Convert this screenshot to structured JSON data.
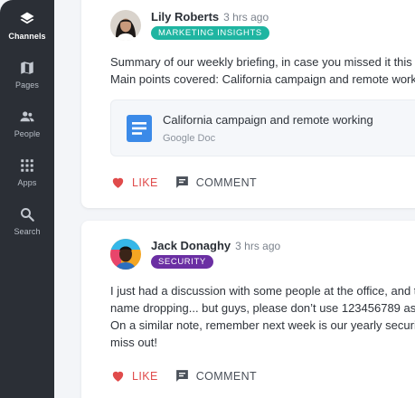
{
  "sidebar": {
    "items": [
      {
        "label": "Channels",
        "icon": "layers-icon",
        "active": true
      },
      {
        "label": "Pages",
        "icon": "map-pages-icon",
        "active": false
      },
      {
        "label": "People",
        "icon": "people-icon",
        "active": false
      },
      {
        "label": "Apps",
        "icon": "apps-grid-icon",
        "active": false
      },
      {
        "label": "Search",
        "icon": "search-icon",
        "active": false
      }
    ]
  },
  "posts": [
    {
      "author": "Lily Roberts",
      "time": "3 hrs ago",
      "badge": "MARKETING INSIGHTS",
      "badge_color": "#1fb5a1",
      "body": [
        "Summary of our weekly briefing, in case you missed it this t",
        "Main points covered: California campaign and remote worki"
      ],
      "attachment": {
        "title": "California campaign and remote working",
        "type": "Google Doc",
        "icon": "google-doc-icon",
        "icon_color": "#3b8ae8"
      },
      "like_label": "LIKE",
      "comment_label": "COMMENT"
    },
    {
      "author": "Jack Donaghy",
      "time": "3 hrs ago",
      "badge": "SECURITY",
      "badge_color": "#6b2fa3",
      "body": [
        "I just had a discussion with some people at the office, and t",
        "name dropping... but guys, please don’t use 123456789 as",
        "On a similar note, remember next week is our yearly securi",
        "miss out!"
      ],
      "like_label": "LIKE",
      "comment_label": "COMMENT"
    }
  ],
  "colors": {
    "sidebar_bg": "#2b2f36",
    "like": "#e04b4b",
    "comment": "#4a5059"
  }
}
